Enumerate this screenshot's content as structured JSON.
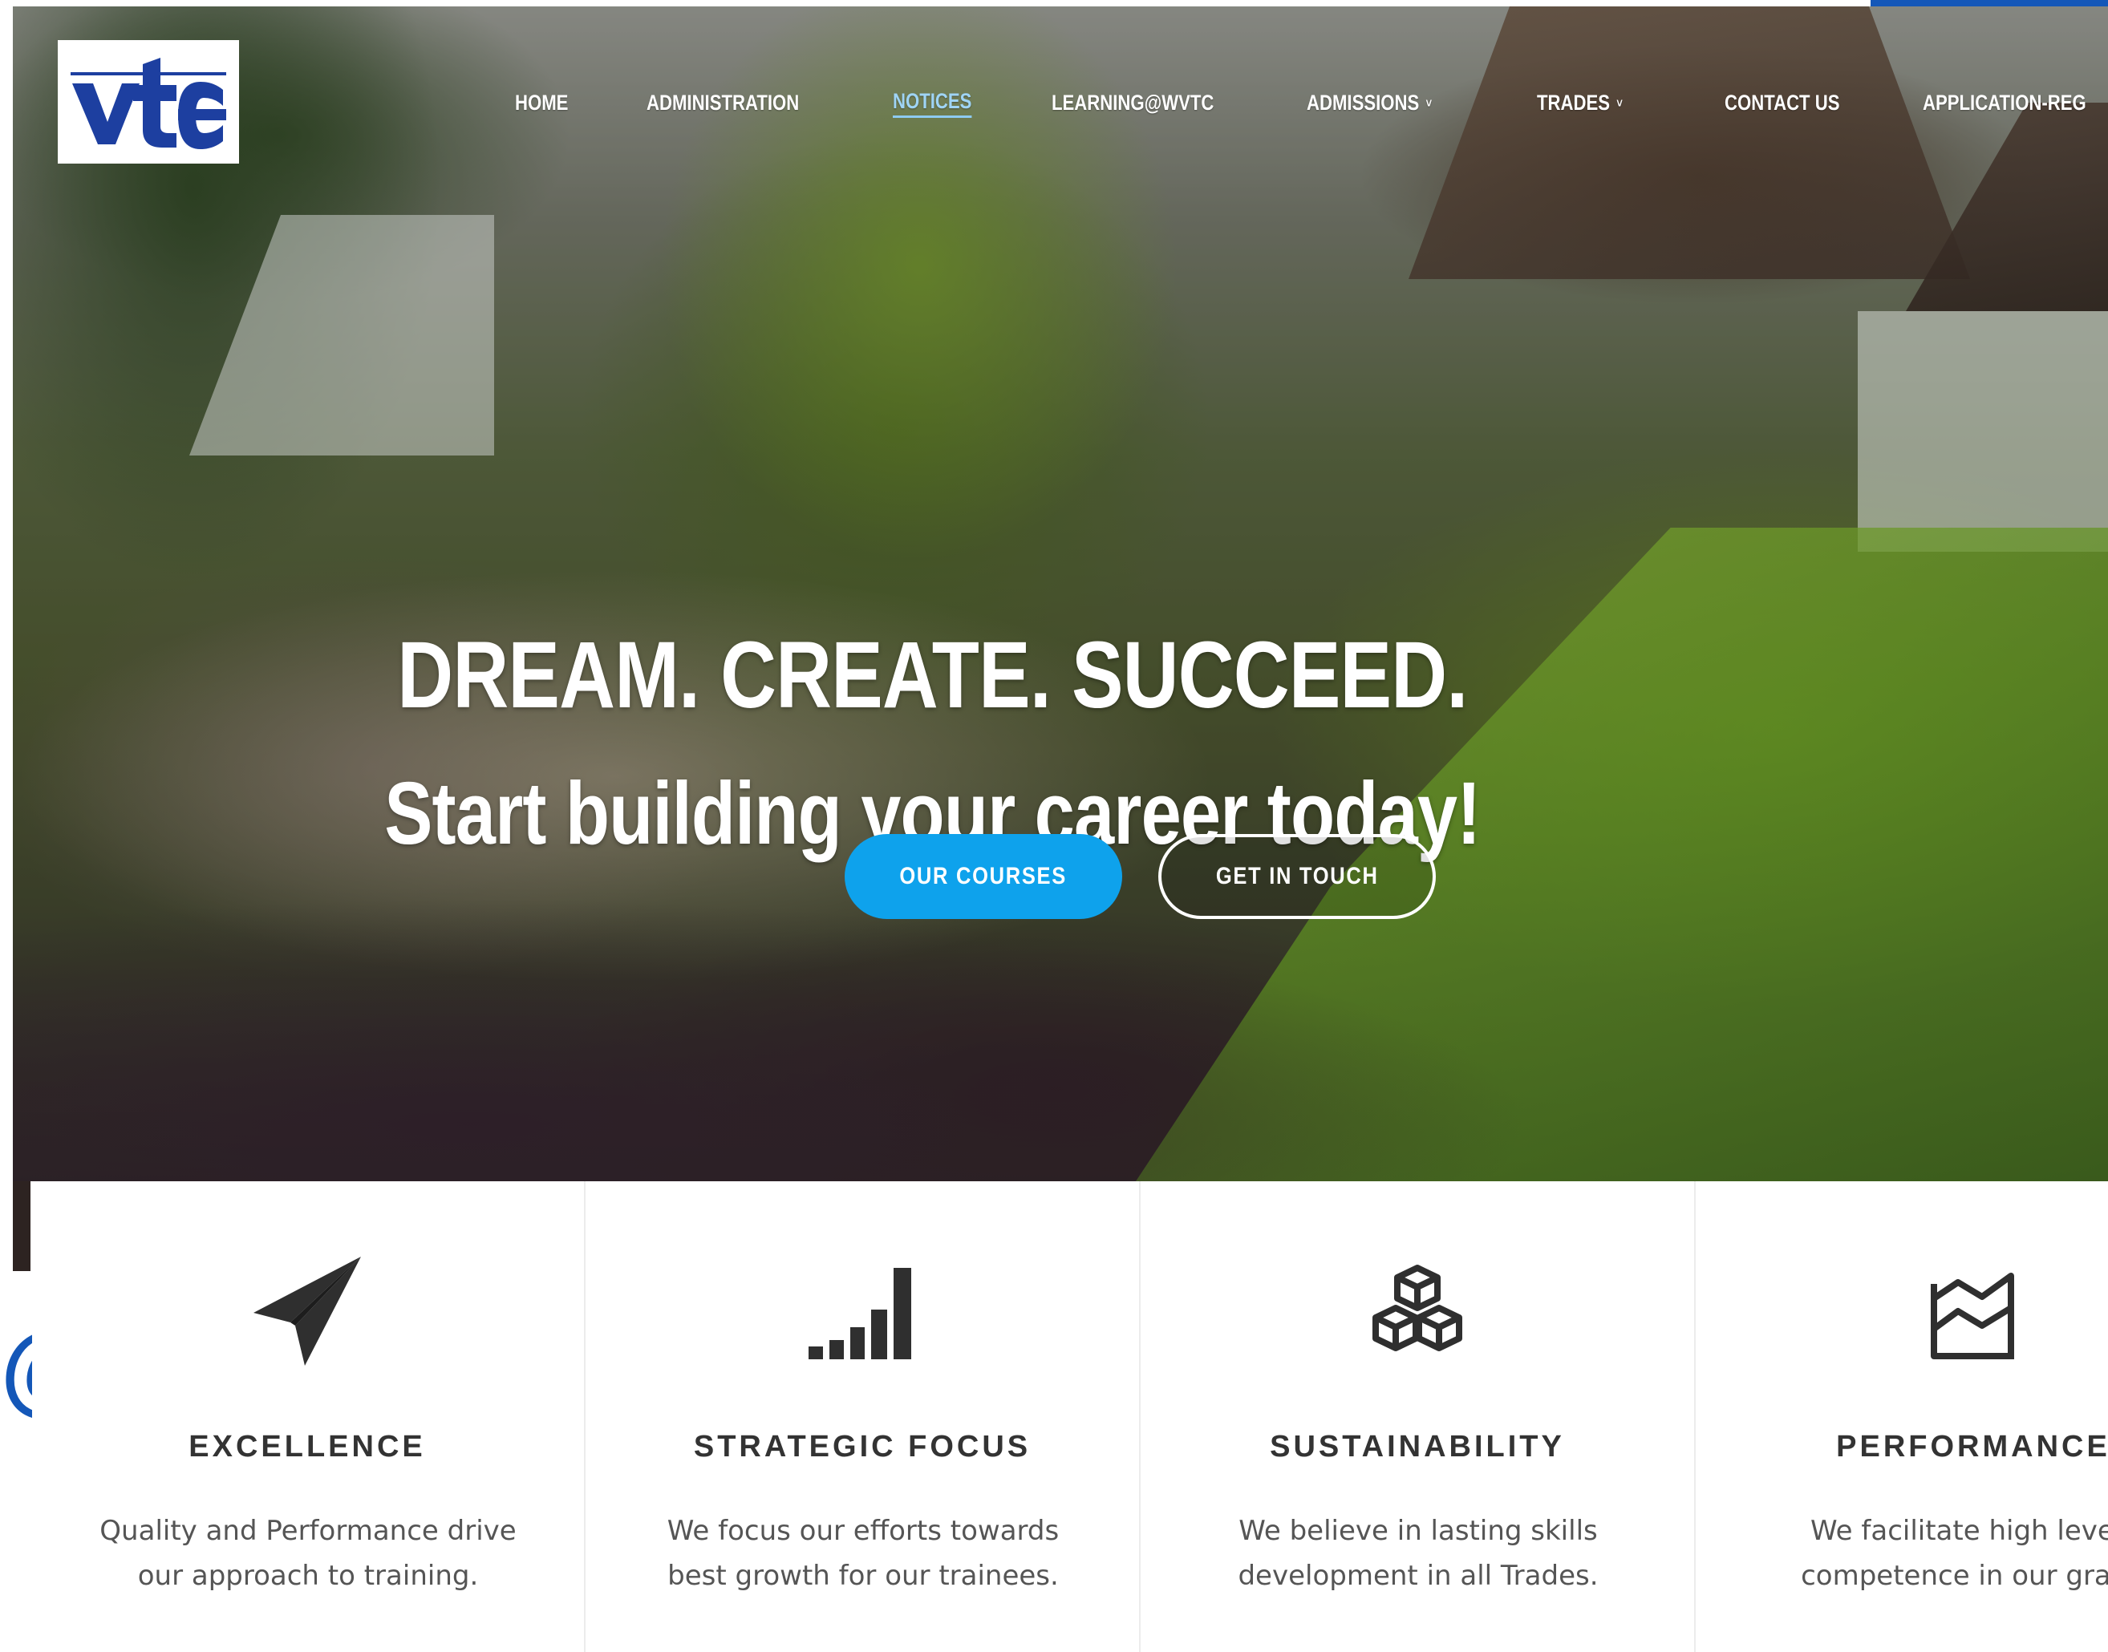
{
  "brand": {
    "logo_text": "vtc",
    "logo_color": "#1d3fa0"
  },
  "nav": {
    "items": [
      {
        "label": "HOME",
        "has_dropdown": false,
        "active": false
      },
      {
        "label": "ADMINISTRATION",
        "has_dropdown": false,
        "active": false
      },
      {
        "label": "NOTICES",
        "has_dropdown": false,
        "active": true
      },
      {
        "label": "LEARNING@WVTC",
        "has_dropdown": false,
        "active": false
      },
      {
        "label": "ADMISSIONS",
        "has_dropdown": true,
        "active": false
      },
      {
        "label": "TRADES",
        "has_dropdown": true,
        "active": false
      },
      {
        "label": "CONTACT US",
        "has_dropdown": false,
        "active": false
      },
      {
        "label": "APPLICATION-REG",
        "has_dropdown": false,
        "active": false
      }
    ],
    "caret_glyph": "˅"
  },
  "hero": {
    "title": "DREAM. CREATE. SUCCEED.",
    "subtitle": "Start building your career today!",
    "primary_button": "OUR COURSES",
    "secondary_button": "GET IN TOUCH",
    "accent_color": "#0ea2ec"
  },
  "features": [
    {
      "icon": "paper-plane-icon",
      "title": "EXCELLENCE",
      "line1": "Quality and Performance drive",
      "line2": "our approach to training."
    },
    {
      "icon": "signal-bars-icon",
      "title": "STRATEGIC FOCUS",
      "line1": "We focus our efforts towards",
      "line2": "best growth for our trainees."
    },
    {
      "icon": "cubes-icon",
      "title": "SUSTAINABILITY",
      "line1": "We believe in lasting skills",
      "line2": "development in all Trades."
    },
    {
      "icon": "area-chart-icon",
      "title": "PERFORMANCE",
      "line1": "We facilitate high levels",
      "line2": "competence in our gradu"
    }
  ],
  "side_overlay": {
    "glyph": "@",
    "color": "#1457b8"
  }
}
